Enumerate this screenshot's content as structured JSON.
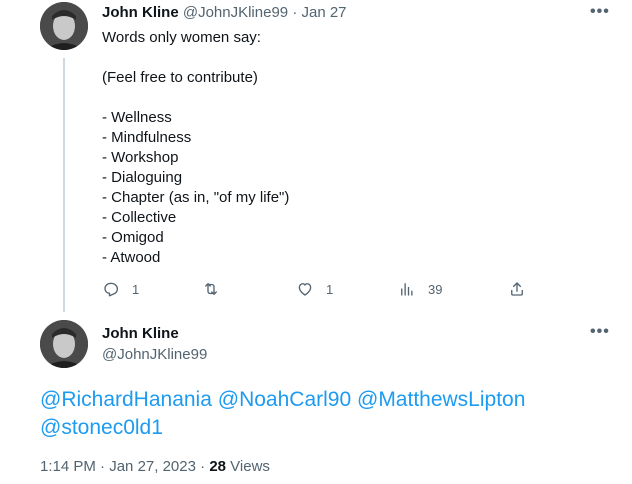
{
  "tweet1": {
    "author_name": "John Kline",
    "author_handle": "@JohnJKline99",
    "separator": "·",
    "date": "Jan 27",
    "more_label": "•••",
    "body_lines": [
      "Words only women say:",
      "",
      "(Feel free to contribute)",
      "",
      "- Wellness",
      "- Mindfulness",
      "- Workshop",
      "- Dialoguing",
      "- Chapter (as in, \"of my life\")",
      "- Collective",
      "- Omigod",
      "- Atwood"
    ],
    "actions": {
      "reply_count": "1",
      "retweet_count": "",
      "like_count": "1",
      "views_count": "39"
    }
  },
  "tweet2": {
    "author_name": "John Kline",
    "author_handle": "@JohnJKline99",
    "more_label": "•••",
    "mentions": [
      "@RichardHanania",
      "@NoahCarl90",
      "@MatthewsLipton",
      "@stonec0ld1"
    ],
    "time": "1:14 PM",
    "separator": "·",
    "date": "Jan 27, 2023",
    "separator2": "·",
    "views_count": "28",
    "views_label": "Views"
  },
  "colors": {
    "accent": "#1d9bf0",
    "text_primary": "#0f1419",
    "text_secondary": "#536471",
    "thread_line": "#cfd9de"
  },
  "icons": [
    "reply-icon",
    "retweet-icon",
    "like-icon",
    "views-icon",
    "share-icon",
    "more-icon"
  ]
}
